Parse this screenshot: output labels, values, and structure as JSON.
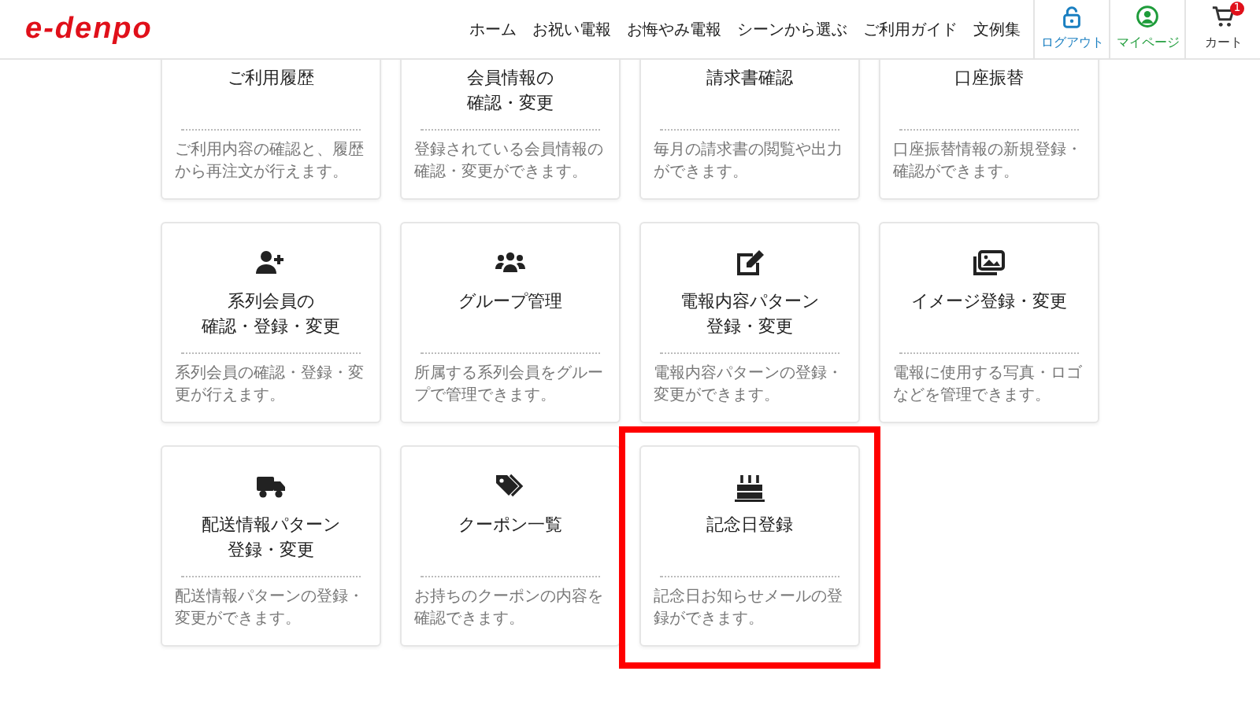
{
  "header": {
    "logo": "e-denpo",
    "nav": [
      "ホーム",
      "お祝い電報",
      "お悔やみ電報",
      "シーンから選ぶ",
      "ご利用ガイド",
      "文例集"
    ],
    "actions": [
      {
        "kind": "lock",
        "label": "ログアウト",
        "color": "#1a7fc1"
      },
      {
        "kind": "user",
        "label": "マイページ",
        "color": "#1e9c3a"
      },
      {
        "kind": "cart",
        "label": "カート",
        "color": "#333333",
        "badge": "1"
      }
    ]
  },
  "cards": [
    {
      "kind": "plain",
      "title": [
        "ご利用履歴"
      ],
      "description": "ご利用内容の確認と、履歴から再注文が行えます。",
      "highlighted": false
    },
    {
      "kind": "plain",
      "title": [
        "会員情報の",
        "確認・変更"
      ],
      "description": "登録されている会員情報の確認・変更ができます。",
      "highlighted": false
    },
    {
      "kind": "plain",
      "title": [
        "請求書確認"
      ],
      "description": "毎月の請求書の閲覧や出力ができます。",
      "highlighted": false
    },
    {
      "kind": "plain",
      "title": [
        "口座振替"
      ],
      "description": "口座振替情報の新規登録・確認ができます。",
      "highlighted": false
    },
    {
      "kind": "member",
      "title": [
        "系列会員の",
        "確認・登録・変更"
      ],
      "description": "系列会員の確認・登録・変更が行えます。",
      "highlighted": false
    },
    {
      "kind": "group",
      "title": [
        "グループ管理"
      ],
      "description": "所属する系列会員をグループで管理できます。",
      "highlighted": false
    },
    {
      "kind": "pattern",
      "title": [
        "電報内容パターン",
        "登録・変更"
      ],
      "description": "電報内容パターンの登録・変更ができます。",
      "highlighted": false
    },
    {
      "kind": "image",
      "title": [
        "イメージ登録・変更"
      ],
      "description": "電報に使用する写真・ロゴなどを管理できます。",
      "highlighted": false
    },
    {
      "kind": "delivery",
      "title": [
        "配送情報パターン",
        "登録・変更"
      ],
      "description": "配送情報パターンの登録・変更ができます。",
      "highlighted": false
    },
    {
      "kind": "coupon",
      "title": [
        "クーポン一覧"
      ],
      "description": "お持ちのクーポンの内容を確認できます。",
      "highlighted": false
    },
    {
      "kind": "anniversary",
      "title": [
        "記念日登録"
      ],
      "description": "記念日お知らせメールの登録ができます。",
      "highlighted": true
    }
  ]
}
